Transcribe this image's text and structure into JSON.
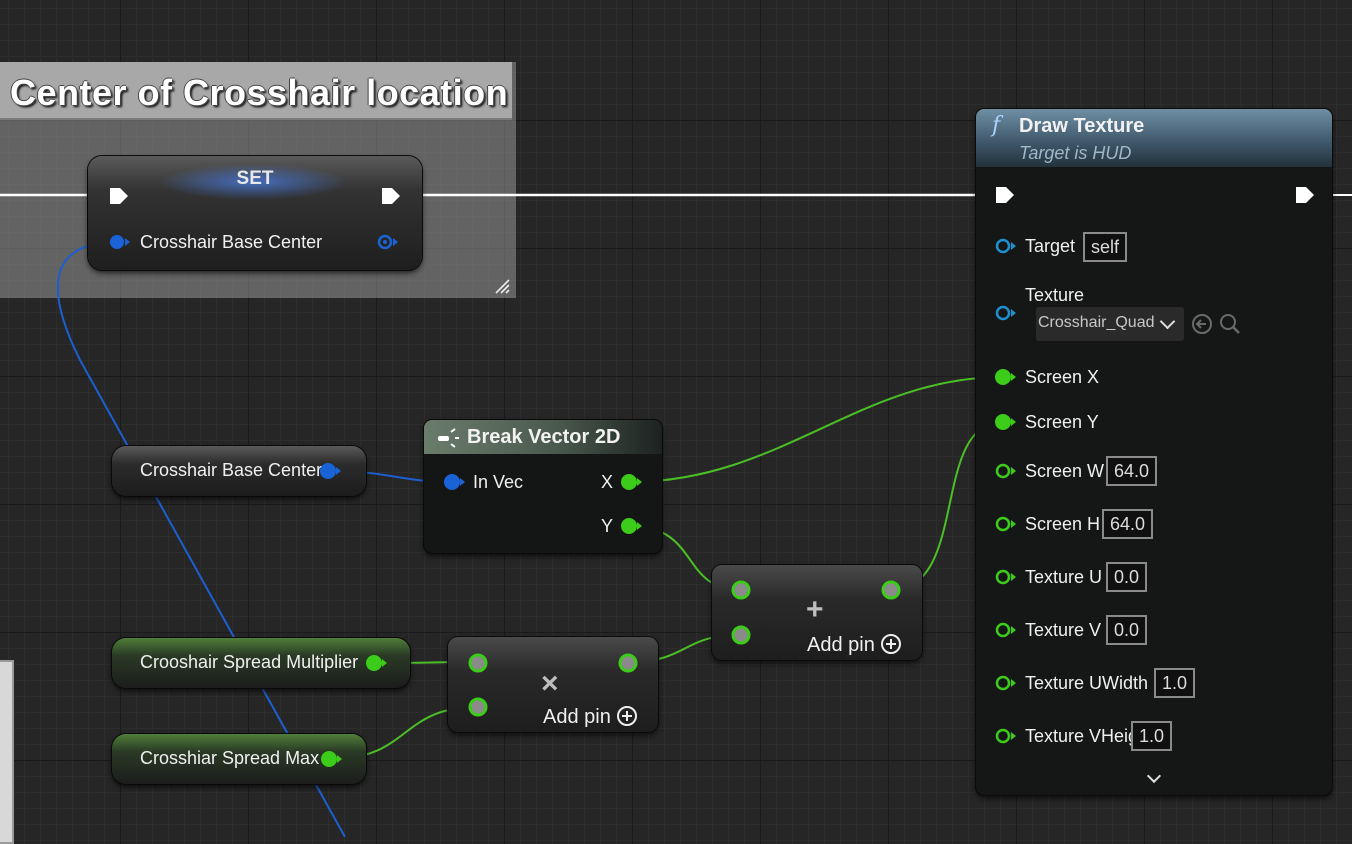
{
  "comment": {
    "title": "Center of Crosshair location"
  },
  "set_node": {
    "title": "SET",
    "pin_label": "Crosshair Base Center"
  },
  "getters": {
    "base_center": "Crosshair Base Center",
    "spread_multiplier": "Crooshair Spread Multiplier",
    "spread_max": "Crosshiar Spread Max"
  },
  "break_vector": {
    "title": "Break Vector 2D",
    "input": "In Vec",
    "out_x": "X",
    "out_y": "Y"
  },
  "multiply_node": {
    "symbol": "×",
    "add_pin": "Add pin"
  },
  "add_node": {
    "symbol": "+",
    "add_pin": "Add pin"
  },
  "draw_texture": {
    "title": "Draw Texture",
    "subtitle": "Target is HUD",
    "pins": {
      "target": {
        "label": "Target",
        "value": "self"
      },
      "texture": {
        "label": "Texture",
        "value": "Crosshair_Quad"
      },
      "screen_x": {
        "label": "Screen X"
      },
      "screen_y": {
        "label": "Screen Y"
      },
      "screen_w": {
        "label": "Screen W",
        "value": "64.0"
      },
      "screen_h": {
        "label": "Screen H",
        "value": "64.0"
      },
      "texture_u": {
        "label": "Texture U",
        "value": "0.0"
      },
      "texture_v": {
        "label": "Texture V",
        "value": "0.0"
      },
      "texture_uwidth": {
        "label": "Texture UWidth",
        "value": "1.0"
      },
      "texture_vheight": {
        "label": "Texture VHeight",
        "value": "1.0"
      }
    }
  },
  "colors": {
    "exec": "#ffffff",
    "struct_pin": "#1a63d6",
    "float_pin": "#3ccc1a",
    "object_pin": "#1e8fcf",
    "float_wire": "#4bbf25",
    "struct_wire": "#1c5fd1"
  }
}
